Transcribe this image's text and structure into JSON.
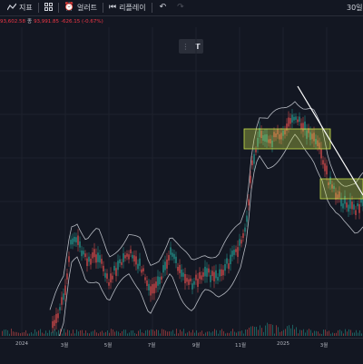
{
  "toolbar": {
    "indicators_label": "지표",
    "alerts_label": "얼러트",
    "replay_label": "리플레이",
    "right_label": "30일"
  },
  "ohlc": {
    "high": "93,602.58",
    "low_label": "종",
    "close": "93,991.85",
    "change": "-626.15 (-0.67%)"
  },
  "center_box": {
    "label": "T"
  },
  "colors": {
    "background": "#131722",
    "up": "#26a69a",
    "down": "#ef5350",
    "band": "#e0e3eb",
    "zone_fill": "#c8e04a"
  },
  "x_axis": {
    "labels": [
      "2024",
      "3월",
      "5월",
      "7월",
      "9월",
      "11월",
      "2025",
      "3월"
    ]
  }
}
